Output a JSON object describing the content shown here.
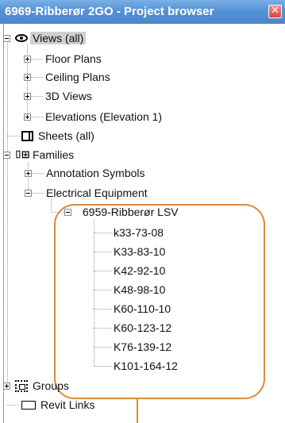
{
  "window": {
    "title": "6969-Ribberør 2GO - Project browser",
    "close_glyph": "✕"
  },
  "tree": {
    "views_all": "Views (all)",
    "floor_plans": "Floor Plans",
    "ceiling_plans": "Ceiling Plans",
    "views_3d": "3D Views",
    "elevations": "Elevations (Elevation 1)",
    "sheets_all": "Sheets (all)",
    "families": "Families",
    "annotation_symbols": "Annotation Symbols",
    "electrical_equipment": "Electrical Equipment",
    "family_ribberor": "6959-Ribberør LSV",
    "types": [
      "k33-73-08",
      "K33-83-10",
      "K42-92-10",
      "K48-98-10",
      "K60-110-10",
      "K60-123-12",
      "K76-139-12",
      "K101-164-12"
    ],
    "groups": "Groups",
    "revit_links": "Revit Links"
  },
  "annotation": {
    "highlight_color": "#d98a3a"
  },
  "icons": {
    "views": "eye-icon",
    "sheets": "sheet-icon",
    "families": "family-icon",
    "families_glyph": "⌷⊞",
    "groups": "groups-icon",
    "revit_links": "link-icon"
  }
}
